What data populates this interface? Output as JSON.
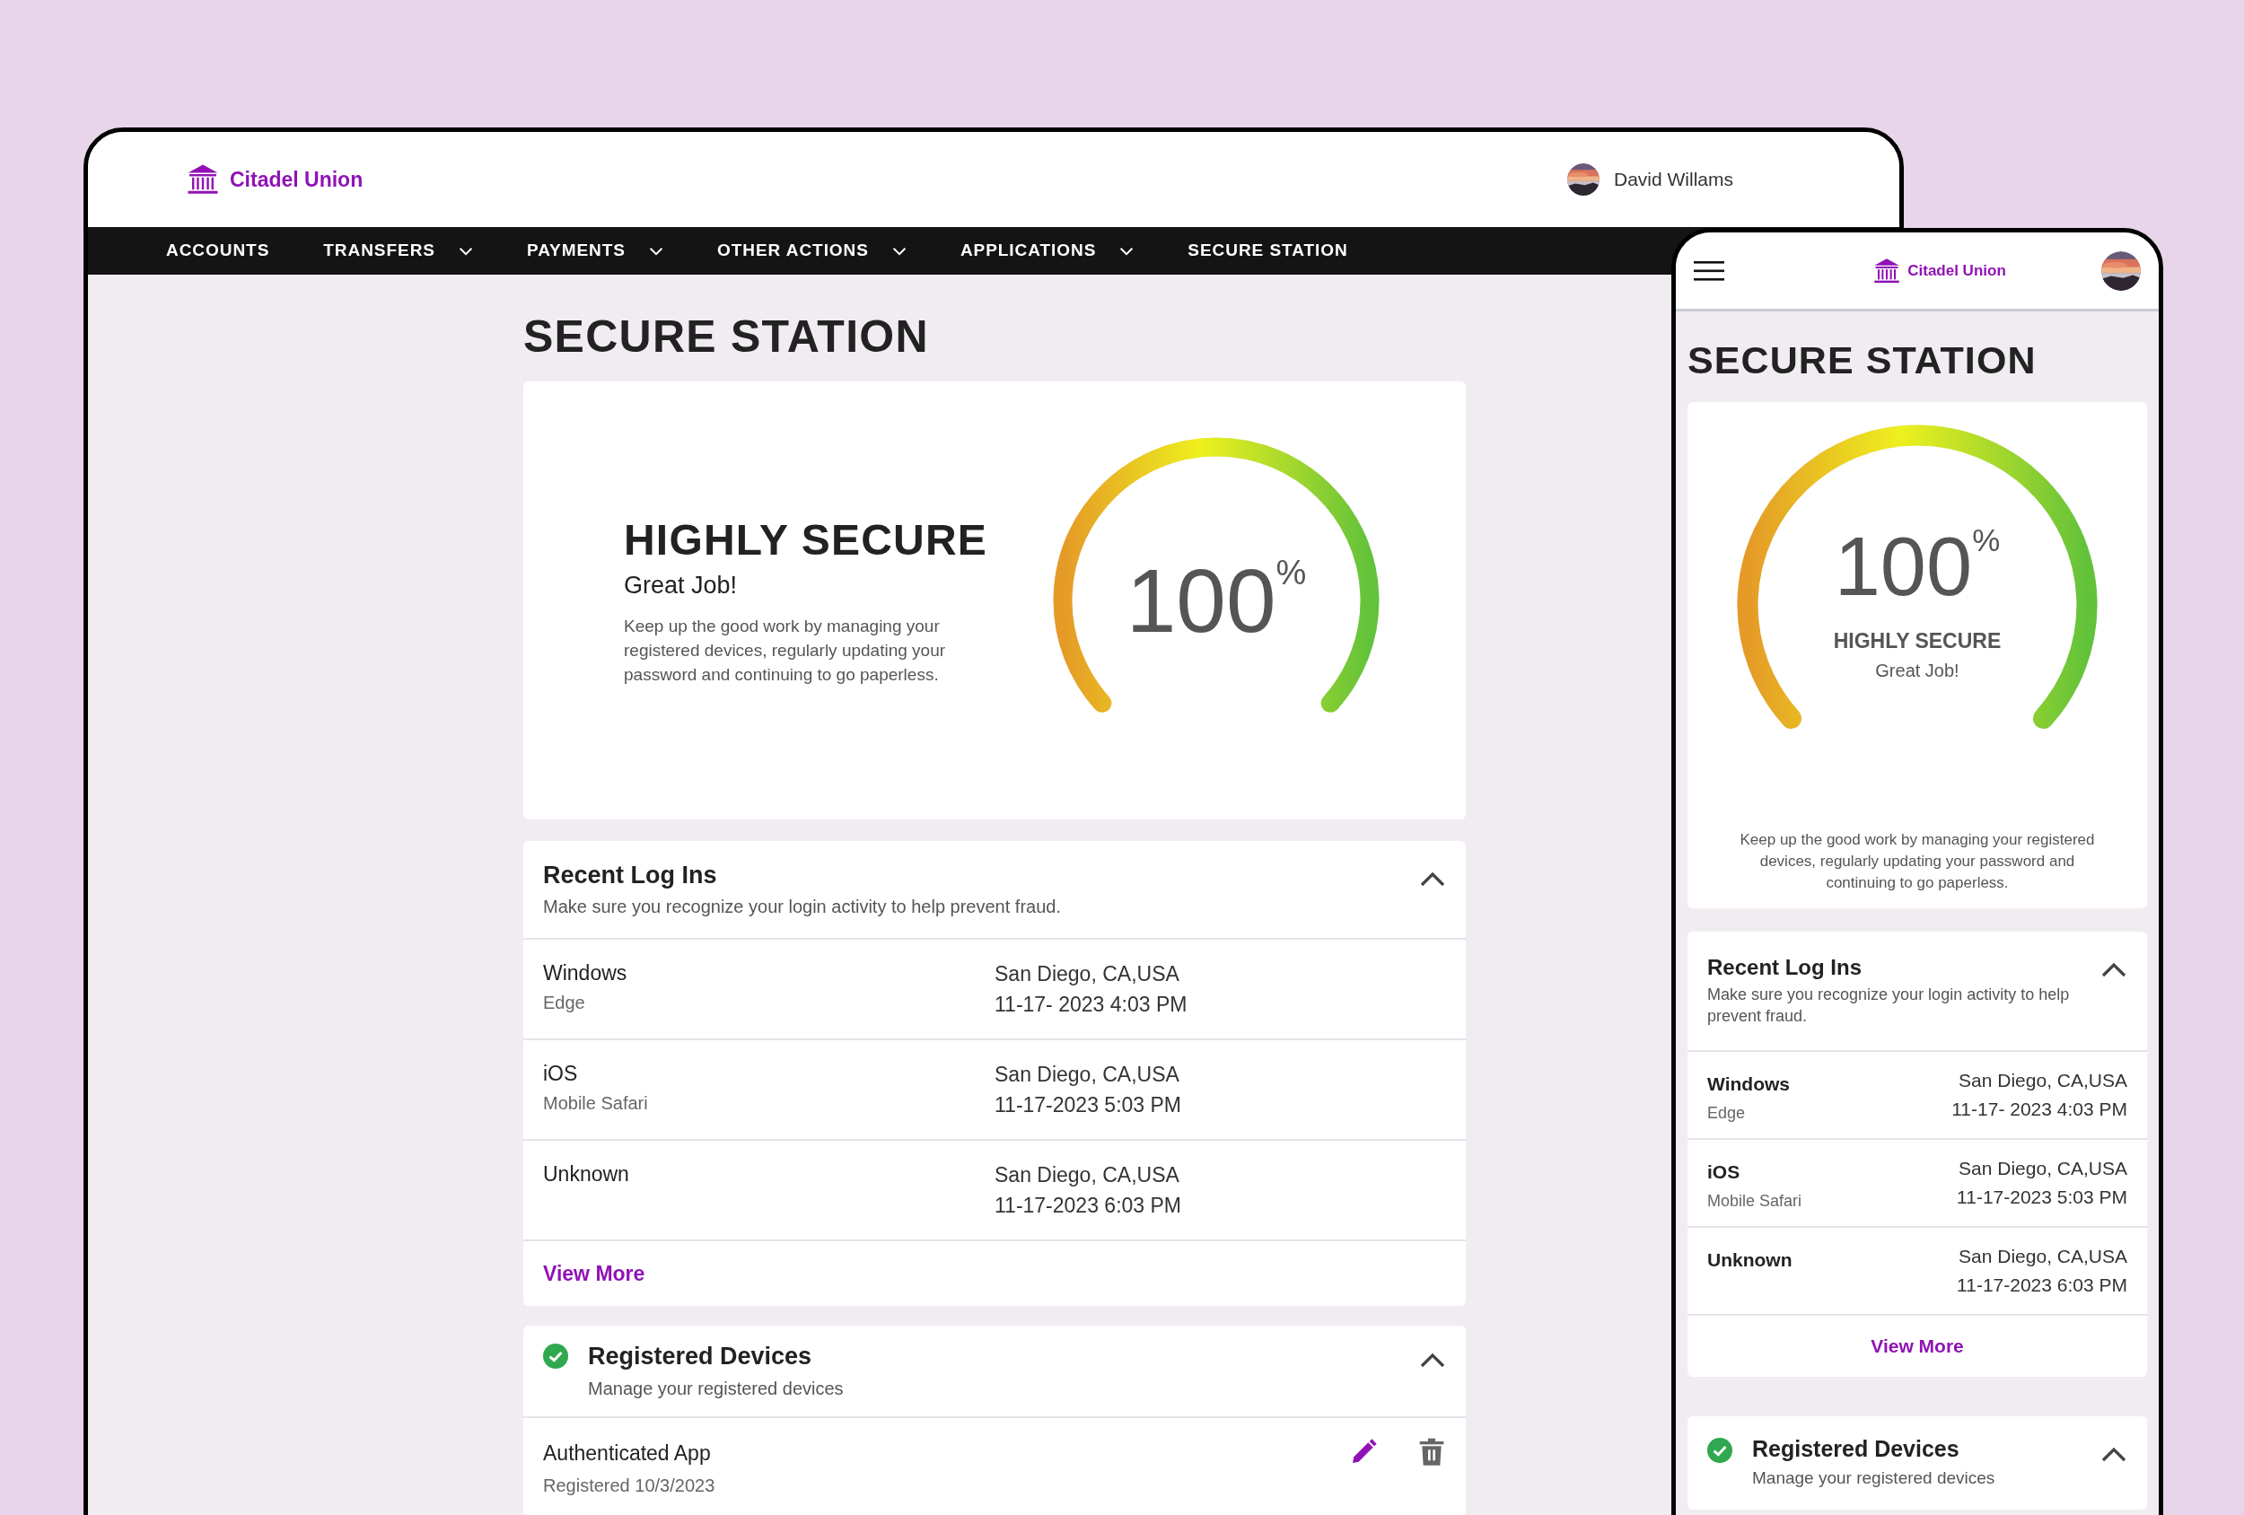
{
  "desktop": {
    "brand": "Citadel Union",
    "user": "David Willams",
    "nav": [
      {
        "label": "ACCOUNTS",
        "dropdown": false
      },
      {
        "label": "TRANSFERS",
        "dropdown": true
      },
      {
        "label": "PAYMENTS",
        "dropdown": true
      },
      {
        "label": "OTHER ACTIONS",
        "dropdown": true
      },
      {
        "label": "APPLICATIONS",
        "dropdown": true
      },
      {
        "label": "SECURE STATION",
        "dropdown": false
      }
    ],
    "title": "SECURE STATION",
    "score": {
      "heading": "HIGHLY SECURE",
      "subheading": "Great Job!",
      "description": "Keep up the good work by managing your registered devices, regularly updating your password and continuing to go paperless.",
      "value": "100",
      "unit": "%",
      "level": 1
    },
    "recent": {
      "title": "Recent Log Ins",
      "subtitle": "Make sure you recognize your login activity to help prevent fraud.",
      "expanded": true,
      "rows": [
        {
          "os": "Windows",
          "browser": "Edge",
          "location": "San Diego, CA,USA",
          "time": "11-17- 2023 4:03 PM"
        },
        {
          "os": "iOS",
          "browser": "Mobile Safari",
          "location": "San Diego, CA,USA",
          "time": "11-17-2023 5:03 PM"
        },
        {
          "os": "Unknown",
          "location": "San Diego, CA,USA",
          "time": "11-17-2023 6:03 PM"
        }
      ],
      "link": "View More"
    },
    "devices": {
      "title": "Registered Devices",
      "subtitle": "Manage your registered devices",
      "expanded": true,
      "verified": true,
      "rows": [
        {
          "name": "Authenticated App",
          "date": "Registered 10/3/2023"
        }
      ]
    }
  },
  "mobile": {
    "brand": "Citadel Union",
    "title": "SECURE STATION",
    "score": {
      "heading": "HIGHLY SECURE",
      "subheading": "Great Job!",
      "description": "Keep up the good work by managing your registered devices, regularly updating your password and continuing to go paperless.",
      "value": "100",
      "unit": "%",
      "level": 1
    },
    "recent": {
      "title": "Recent Log Ins",
      "subtitle": "Make sure you recognize your login activity to help prevent fraud.",
      "expanded": true,
      "rows": [
        {
          "os": "Windows",
          "browser": "Edge",
          "location": "San Diego, CA,USA",
          "time": "11-17- 2023 4:03 PM"
        },
        {
          "os": "iOS",
          "browser": "Mobile Safari",
          "location": "San Diego, CA,USA",
          "time": "11-17-2023 5:03 PM"
        },
        {
          "os": "Unknown",
          "location": "San Diego, CA,USA",
          "time": "11-17-2023 6:03 PM"
        }
      ],
      "link": "View More"
    },
    "devices": {
      "title": "Registered Devices",
      "subtitle": "Manage your registered devices",
      "expanded": true,
      "verified": true
    }
  }
}
